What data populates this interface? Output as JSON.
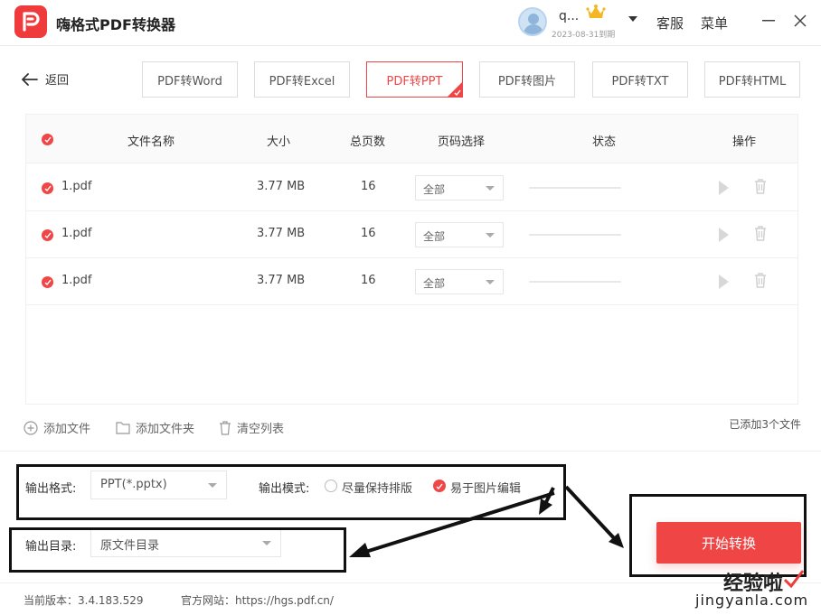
{
  "app": {
    "title": "嗨格式PDF转换器"
  },
  "user": {
    "name": "q...",
    "expire": "2023-08-31到期"
  },
  "topbar": {
    "service": "客服",
    "menu": "菜单"
  },
  "nav": {
    "back": "返回"
  },
  "tabs": [
    {
      "label": "PDF转Word",
      "active": false
    },
    {
      "label": "PDF转Excel",
      "active": false
    },
    {
      "label": "PDF转PPT",
      "active": true
    },
    {
      "label": "PDF转图片",
      "active": false
    },
    {
      "label": "PDF转TXT",
      "active": false
    },
    {
      "label": "PDF转HTML",
      "active": false
    }
  ],
  "table": {
    "headers": {
      "name": "文件名称",
      "size": "大小",
      "pages": "总页数",
      "range": "页码选择",
      "status": "状态",
      "ops": "操作"
    },
    "rows": [
      {
        "name": "1.pdf",
        "size": "3.77 MB",
        "pages": "16",
        "range": "全部",
        "progress": 0
      },
      {
        "name": "1.pdf",
        "size": "3.77 MB",
        "pages": "16",
        "range": "全部",
        "progress": 0
      },
      {
        "name": "1.pdf",
        "size": "3.77 MB",
        "pages": "16",
        "range": "全部",
        "progress": 0
      }
    ]
  },
  "actions": {
    "add_file": "添加文件",
    "add_folder": "添加文件夹",
    "clear": "清空列表",
    "count": "已添加3个文件"
  },
  "settings": {
    "format_label": "输出格式:",
    "format_value": "PPT(*.pptx)",
    "mode_label": "输出模式:",
    "mode_option1": "尽量保持排版",
    "mode_option2": "易于图片编辑",
    "dir_label": "输出目录:",
    "dir_value": "原文件目录"
  },
  "start_button": "开始转换",
  "footer": {
    "version": "当前版本：3.4.183.529",
    "site": "官方网站：https://hgs.pdf.cn/"
  },
  "watermark": {
    "cn": "经验啦",
    "en": "jingyanla.com"
  },
  "colors": {
    "accent": "#ef4747"
  }
}
